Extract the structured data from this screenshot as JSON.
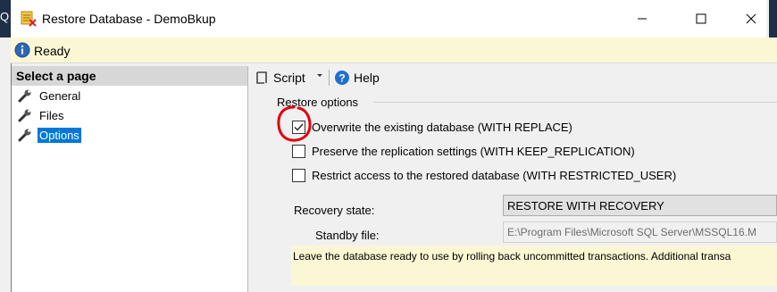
{
  "background_app": {
    "text": "Q"
  },
  "window": {
    "title": "Restore Database - DemoBkup",
    "controls": {
      "minimize": "minimize",
      "maximize": "maximize",
      "close": "close"
    }
  },
  "status": {
    "text": "Ready",
    "icon": "info-icon"
  },
  "left_pane": {
    "header": "Select a page",
    "items": [
      {
        "label": "General",
        "icon": "wrench-icon",
        "selected": false
      },
      {
        "label": "Files",
        "icon": "wrench-icon",
        "selected": false
      },
      {
        "label": "Options",
        "icon": "wrench-icon",
        "selected": true
      }
    ]
  },
  "toolbar": {
    "script_label": "Script",
    "help_label": "Help"
  },
  "restore_options": {
    "group_label": "Restore options",
    "options": [
      {
        "label": "Overwrite the existing database (WITH REPLACE)",
        "checked": true
      },
      {
        "label": "Preserve the replication settings (WITH KEEP_REPLICATION)",
        "checked": false
      },
      {
        "label": "Restrict access to the restored database (WITH RESTRICTED_USER)",
        "checked": false
      }
    ]
  },
  "recovery": {
    "state_label": "Recovery state:",
    "state_value": "RESTORE WITH RECOVERY",
    "standby_label": "Standby file:",
    "standby_value": "E:\\Program Files\\Microsoft SQL Server\\MSSQL16.M",
    "description": "Leave the database ready to use by rolling back uncommitted transactions. Additional transa"
  },
  "colors": {
    "selection": "#0078d7",
    "status_bar": "#fbf7d4",
    "annotation": "#e0000f"
  }
}
